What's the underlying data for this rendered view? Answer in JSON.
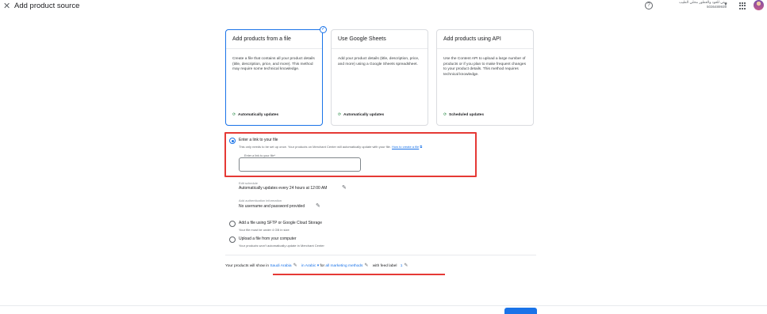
{
  "header": {
    "title": "Add product source",
    "account_name": "بيتي للعود والعطور محلي الطيب",
    "account_id": "5036489939"
  },
  "cards": [
    {
      "title": "Add products from a file",
      "description": "Create a file that contains all your product details (title, description, price, and more). This method may require some technical knowledge.",
      "footer": "Automatically updates",
      "selected": true
    },
    {
      "title": "Use Google Sheets",
      "description": "Add your product details (title, description, price, and more) using a Google Sheets spreadsheet.",
      "footer": "Automatically updates",
      "selected": false
    },
    {
      "title": "Add products using API",
      "description": "Use the Content API to upload a large number of products or if you plan to make frequent changes to your product details. This method requires technical knowledge.",
      "footer": "Scheduled updates",
      "selected": false
    }
  ],
  "options": {
    "link": {
      "label": "Enter a link to your file",
      "description": "This only needs to be set up once. Your products on Merchant Center will automatically update with your file.",
      "help_link": "How to create a file",
      "field_label": "Enter a link to your file*",
      "field_value": ""
    },
    "schedule": {
      "caption": "Edit schedule",
      "value": "Automatically updates every 24 hours at 12:00 AM"
    },
    "auth": {
      "caption": "Add authentication information",
      "value": "No username and password provided"
    },
    "sftp": {
      "label": "Add a file using SFTP or Google Cloud Storage",
      "description": "Your file must be under 4 GB in size"
    },
    "upload": {
      "label": "Upload a file from your computer",
      "description": "Your products won't automatically update in Merchant Center"
    }
  },
  "show_in": {
    "prefix": "Your products will show in",
    "country": "Saudi Arabia",
    "in_word": "in",
    "language": "Arabic",
    "for_word": "for",
    "methods": "all marketing methods",
    "feed_label_prefix": "with feed label",
    "feed_label": "1"
  },
  "icons": {
    "close": "close-icon",
    "help": "help-icon",
    "apps": "apps-grid-icon",
    "sync": "sync-icon",
    "edit": "pencil-icon",
    "external": "open-in-new-icon",
    "check": "check-icon"
  },
  "colors": {
    "accent": "#1a73e8",
    "annotation_red": "#e53935",
    "update_green": "#188038"
  }
}
